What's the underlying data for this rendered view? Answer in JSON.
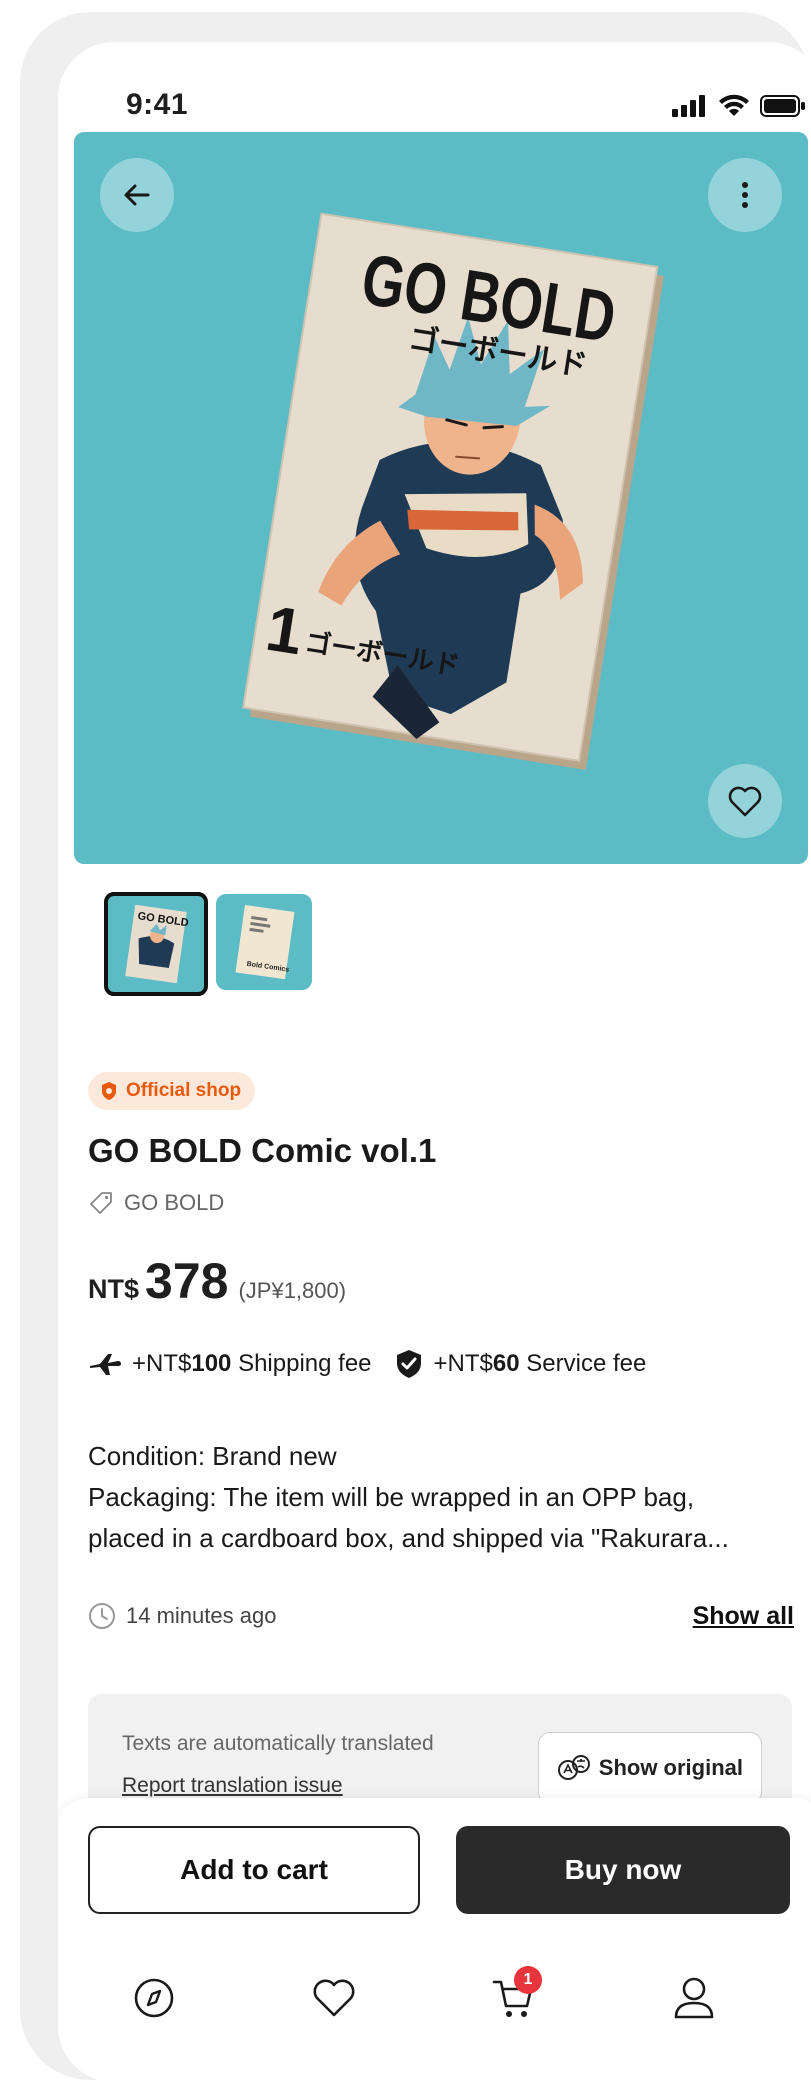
{
  "status_bar": {
    "time": "9:41"
  },
  "hero": {
    "background_color": "#5cbcc6",
    "cover": {
      "title_en": "GO BOLD",
      "title_jp": "ゴーボールド",
      "volume_number": "1",
      "volume_jp": "ゴーボールド"
    }
  },
  "thumbnails": [
    {
      "name": "cover-front",
      "selected": true,
      "label": "GO BOLD"
    },
    {
      "name": "cover-back",
      "selected": false,
      "label": "Bold Comics"
    }
  ],
  "product": {
    "badge": "Official shop",
    "title": "GO BOLD Comic vol.1",
    "brand": "GO BOLD",
    "currency": "NT$",
    "price": "378",
    "original_price": "(JP¥1,800)",
    "shipping": {
      "prefix": "+NT$",
      "amount": "100",
      "label": "Shipping fee"
    },
    "service": {
      "prefix": "+NT$",
      "amount": "60",
      "label": "Service fee"
    },
    "description_lines": [
      "Condition: Brand new",
      "Packaging: The item will be wrapped in an OPP bag,",
      "placed in a cardboard box, and shipped via \"Rakurara..."
    ],
    "posted": "14 minutes ago",
    "show_all": "Show all"
  },
  "translation": {
    "note": "Texts are automatically translated",
    "report": "Report translation issue",
    "show_original": "Show original"
  },
  "actions": {
    "add_to_cart": "Add to cart",
    "buy_now": "Buy now"
  },
  "bottom_nav": {
    "items": [
      "compass-icon",
      "heart-icon",
      "cart-icon",
      "profile-icon"
    ],
    "cart_count": "1"
  },
  "colors": {
    "accent": "#e85b0c",
    "badge_bg": "#fde9dc",
    "primary_button": "#2a2a2a",
    "notification": "#e8343b"
  }
}
